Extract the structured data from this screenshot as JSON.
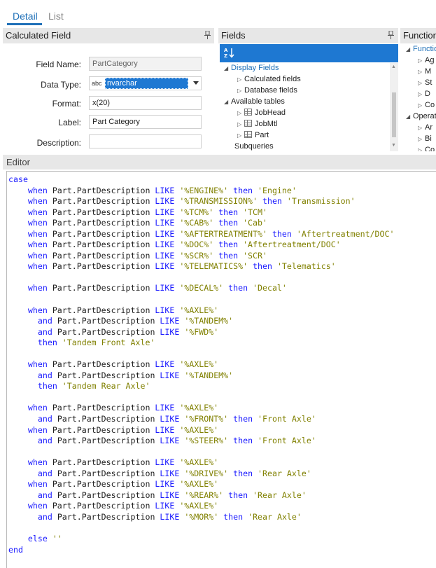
{
  "tabs": [
    {
      "label": "Detail",
      "active": true
    },
    {
      "label": "List",
      "active": false
    }
  ],
  "calc_panel": {
    "title": "Calculated Field",
    "fields": {
      "field_name": {
        "label": "Field Name:",
        "value": "PartCategory"
      },
      "data_type": {
        "label": "Data Type:",
        "value": "nvarchar",
        "type_icon": "abc"
      },
      "format": {
        "label": "Format:",
        "value": "x(20)"
      },
      "field_label": {
        "label": "Label:",
        "value": "Part Category"
      },
      "description": {
        "label": "Description:",
        "value": ""
      }
    }
  },
  "fields_panel": {
    "title": "Fields",
    "sort_icon": "sort-az-icon",
    "tree": [
      {
        "label": "Display Fields",
        "level": 0,
        "expanded": true,
        "highlight": true
      },
      {
        "label": "Calculated fields",
        "level": 1,
        "expanded": false
      },
      {
        "label": "Database fields",
        "level": 1,
        "expanded": false
      },
      {
        "label": "Available tables",
        "level": 0,
        "expanded": true
      },
      {
        "label": "JobHead",
        "level": 1,
        "table": true
      },
      {
        "label": "JobMtl",
        "level": 1,
        "table": true
      },
      {
        "label": "Part",
        "level": 1,
        "table": true
      },
      {
        "label": "Subqueries",
        "level": 0
      }
    ]
  },
  "functions_panel": {
    "title": "Functions",
    "tree": [
      {
        "label": "Functions",
        "level": 0,
        "highlight": true
      },
      {
        "label": "Ag",
        "level": 1
      },
      {
        "label": "M",
        "level": 1
      },
      {
        "label": "St",
        "level": 1
      },
      {
        "label": "D",
        "level": 1
      },
      {
        "label": "Co",
        "level": 1
      },
      {
        "label": "Operators",
        "level": 0
      },
      {
        "label": "Ar",
        "level": 1
      },
      {
        "label": "Bi",
        "level": 1
      },
      {
        "label": "Co",
        "level": 1
      }
    ]
  },
  "editor": {
    "title": "Editor",
    "code_lines": [
      [
        [
          "kw",
          "case"
        ]
      ],
      [
        [
          "t",
          "    "
        ],
        [
          "kw",
          "when"
        ],
        [
          "t",
          " Part.PartDescription "
        ],
        [
          "kw",
          "LIKE"
        ],
        [
          "t",
          " "
        ],
        [
          "str",
          "'%ENGINE%'"
        ],
        [
          "t",
          " "
        ],
        [
          "kw",
          "then"
        ],
        [
          "t",
          " "
        ],
        [
          "str",
          "'Engine'"
        ]
      ],
      [
        [
          "t",
          "    "
        ],
        [
          "kw",
          "when"
        ],
        [
          "t",
          " Part.PartDescription "
        ],
        [
          "kw",
          "LIKE"
        ],
        [
          "t",
          " "
        ],
        [
          "str",
          "'%TRANSMISSION%'"
        ],
        [
          "t",
          " "
        ],
        [
          "kw",
          "then"
        ],
        [
          "t",
          " "
        ],
        [
          "str",
          "'Transmission'"
        ]
      ],
      [
        [
          "t",
          "    "
        ],
        [
          "kw",
          "when"
        ],
        [
          "t",
          " Part.PartDescription "
        ],
        [
          "kw",
          "LIKE"
        ],
        [
          "t",
          " "
        ],
        [
          "str",
          "'%TCM%'"
        ],
        [
          "t",
          " "
        ],
        [
          "kw",
          "then"
        ],
        [
          "t",
          " "
        ],
        [
          "str",
          "'TCM'"
        ]
      ],
      [
        [
          "t",
          "    "
        ],
        [
          "kw",
          "when"
        ],
        [
          "t",
          " Part.PartDescription "
        ],
        [
          "kw",
          "LIKE"
        ],
        [
          "t",
          " "
        ],
        [
          "str",
          "'%CAB%'"
        ],
        [
          "t",
          " "
        ],
        [
          "kw",
          "then"
        ],
        [
          "t",
          " "
        ],
        [
          "str",
          "'Cab'"
        ]
      ],
      [
        [
          "t",
          "    "
        ],
        [
          "kw",
          "when"
        ],
        [
          "t",
          " Part.PartDescription "
        ],
        [
          "kw",
          "LIKE"
        ],
        [
          "t",
          " "
        ],
        [
          "str",
          "'%AFTERTREATMENT%'"
        ],
        [
          "t",
          " "
        ],
        [
          "kw",
          "then"
        ],
        [
          "t",
          " "
        ],
        [
          "str",
          "'Aftertreatment/DOC'"
        ]
      ],
      [
        [
          "t",
          "    "
        ],
        [
          "kw",
          "when"
        ],
        [
          "t",
          " Part.PartDescription "
        ],
        [
          "kw",
          "LIKE"
        ],
        [
          "t",
          " "
        ],
        [
          "str",
          "'%DOC%'"
        ],
        [
          "t",
          " "
        ],
        [
          "kw",
          "then"
        ],
        [
          "t",
          " "
        ],
        [
          "str",
          "'Aftertreatment/DOC'"
        ]
      ],
      [
        [
          "t",
          "    "
        ],
        [
          "kw",
          "when"
        ],
        [
          "t",
          " Part.PartDescription "
        ],
        [
          "kw",
          "LIKE"
        ],
        [
          "t",
          " "
        ],
        [
          "str",
          "'%SCR%'"
        ],
        [
          "t",
          " "
        ],
        [
          "kw",
          "then"
        ],
        [
          "t",
          " "
        ],
        [
          "str",
          "'SCR'"
        ]
      ],
      [
        [
          "t",
          "    "
        ],
        [
          "kw",
          "when"
        ],
        [
          "t",
          " Part.PartDescription "
        ],
        [
          "kw",
          "LIKE"
        ],
        [
          "t",
          " "
        ],
        [
          "str",
          "'%TELEMATICS%'"
        ],
        [
          "t",
          " "
        ],
        [
          "kw",
          "then"
        ],
        [
          "t",
          " "
        ],
        [
          "str",
          "'Telematics'"
        ]
      ],
      [],
      [
        [
          "t",
          "    "
        ],
        [
          "kw",
          "when"
        ],
        [
          "t",
          " Part.PartDescription "
        ],
        [
          "kw",
          "LIKE"
        ],
        [
          "t",
          " "
        ],
        [
          "str",
          "'%DECAL%'"
        ],
        [
          "t",
          " "
        ],
        [
          "kw",
          "then"
        ],
        [
          "t",
          " "
        ],
        [
          "str",
          "'Decal'"
        ]
      ],
      [],
      [
        [
          "t",
          "    "
        ],
        [
          "kw",
          "when"
        ],
        [
          "t",
          " Part.PartDescription "
        ],
        [
          "kw",
          "LIKE"
        ],
        [
          "t",
          " "
        ],
        [
          "str",
          "'%AXLE%'"
        ]
      ],
      [
        [
          "t",
          "      "
        ],
        [
          "kw",
          "and"
        ],
        [
          "t",
          " Part.PartDescription "
        ],
        [
          "kw",
          "LIKE"
        ],
        [
          "t",
          " "
        ],
        [
          "str",
          "'%TANDEM%'"
        ]
      ],
      [
        [
          "t",
          "      "
        ],
        [
          "kw",
          "and"
        ],
        [
          "t",
          " Part.PartDescription "
        ],
        [
          "kw",
          "LIKE"
        ],
        [
          "t",
          " "
        ],
        [
          "str",
          "'%FWD%'"
        ]
      ],
      [
        [
          "t",
          "      "
        ],
        [
          "kw",
          "then"
        ],
        [
          "t",
          " "
        ],
        [
          "str",
          "'Tandem Front Axle'"
        ]
      ],
      [],
      [
        [
          "t",
          "    "
        ],
        [
          "kw",
          "when"
        ],
        [
          "t",
          " Part.PartDescription "
        ],
        [
          "kw",
          "LIKE"
        ],
        [
          "t",
          " "
        ],
        [
          "str",
          "'%AXLE%'"
        ]
      ],
      [
        [
          "t",
          "      "
        ],
        [
          "kw",
          "and"
        ],
        [
          "t",
          " Part.PartDescription "
        ],
        [
          "kw",
          "LIKE"
        ],
        [
          "t",
          " "
        ],
        [
          "str",
          "'%TANDEM%'"
        ]
      ],
      [
        [
          "t",
          "      "
        ],
        [
          "kw",
          "then"
        ],
        [
          "t",
          " "
        ],
        [
          "str",
          "'Tandem Rear Axle'"
        ]
      ],
      [],
      [
        [
          "t",
          "    "
        ],
        [
          "kw",
          "when"
        ],
        [
          "t",
          " Part.PartDescription "
        ],
        [
          "kw",
          "LIKE"
        ],
        [
          "t",
          " "
        ],
        [
          "str",
          "'%AXLE%'"
        ]
      ],
      [
        [
          "t",
          "      "
        ],
        [
          "kw",
          "and"
        ],
        [
          "t",
          " Part.PartDescription "
        ],
        [
          "kw",
          "LIKE"
        ],
        [
          "t",
          " "
        ],
        [
          "str",
          "'%FRONT%'"
        ],
        [
          "t",
          " "
        ],
        [
          "kw",
          "then"
        ],
        [
          "t",
          " "
        ],
        [
          "str",
          "'Front Axle'"
        ]
      ],
      [
        [
          "t",
          "    "
        ],
        [
          "kw",
          "when"
        ],
        [
          "t",
          " Part.PartDescription "
        ],
        [
          "kw",
          "LIKE"
        ],
        [
          "t",
          " "
        ],
        [
          "str",
          "'%AXLE%'"
        ]
      ],
      [
        [
          "t",
          "      "
        ],
        [
          "kw",
          "and"
        ],
        [
          "t",
          " Part.PartDescription "
        ],
        [
          "kw",
          "LIKE"
        ],
        [
          "t",
          " "
        ],
        [
          "str",
          "'%STEER%'"
        ],
        [
          "t",
          " "
        ],
        [
          "kw",
          "then"
        ],
        [
          "t",
          " "
        ],
        [
          "str",
          "'Front Axle'"
        ]
      ],
      [],
      [
        [
          "t",
          "    "
        ],
        [
          "kw",
          "when"
        ],
        [
          "t",
          " Part.PartDescription "
        ],
        [
          "kw",
          "LIKE"
        ],
        [
          "t",
          " "
        ],
        [
          "str",
          "'%AXLE%'"
        ]
      ],
      [
        [
          "t",
          "      "
        ],
        [
          "kw",
          "and"
        ],
        [
          "t",
          " Part.PartDescription "
        ],
        [
          "kw",
          "LIKE"
        ],
        [
          "t",
          " "
        ],
        [
          "str",
          "'%DRIVE%'"
        ],
        [
          "t",
          " "
        ],
        [
          "kw",
          "then"
        ],
        [
          "t",
          " "
        ],
        [
          "str",
          "'Rear Axle'"
        ]
      ],
      [
        [
          "t",
          "    "
        ],
        [
          "kw",
          "when"
        ],
        [
          "t",
          " Part.PartDescription "
        ],
        [
          "kw",
          "LIKE"
        ],
        [
          "t",
          " "
        ],
        [
          "str",
          "'%AXLE%'"
        ]
      ],
      [
        [
          "t",
          "      "
        ],
        [
          "kw",
          "and"
        ],
        [
          "t",
          " Part.PartDescription "
        ],
        [
          "kw",
          "LIKE"
        ],
        [
          "t",
          " "
        ],
        [
          "str",
          "'%REAR%'"
        ],
        [
          "t",
          " "
        ],
        [
          "kw",
          "then"
        ],
        [
          "t",
          " "
        ],
        [
          "str",
          "'Rear Axle'"
        ]
      ],
      [
        [
          "t",
          "    "
        ],
        [
          "kw",
          "when"
        ],
        [
          "t",
          " Part.PartDescription "
        ],
        [
          "kw",
          "LIKE"
        ],
        [
          "t",
          " "
        ],
        [
          "str",
          "'%AXLE%'"
        ]
      ],
      [
        [
          "t",
          "      "
        ],
        [
          "kw",
          "and"
        ],
        [
          "t",
          " Part.PartDescription "
        ],
        [
          "kw",
          "LIKE"
        ],
        [
          "t",
          " "
        ],
        [
          "str",
          "'%MOR%'"
        ],
        [
          "t",
          " "
        ],
        [
          "kw",
          "then"
        ],
        [
          "t",
          " "
        ],
        [
          "str",
          "'Rear Axle'"
        ]
      ],
      [],
      [
        [
          "t",
          "    "
        ],
        [
          "kw",
          "else"
        ],
        [
          "t",
          " "
        ],
        [
          "str",
          "''"
        ]
      ],
      [
        [
          "kw",
          "end"
        ]
      ]
    ]
  }
}
